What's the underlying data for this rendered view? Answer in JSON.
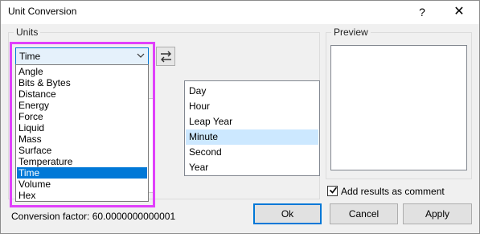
{
  "window": {
    "title": "Unit Conversion",
    "help_glyph": "?",
    "close_glyph": "✕"
  },
  "units_group": {
    "legend": "Units",
    "selected_category": "Time",
    "category_options": [
      "Angle",
      "Bits & Bytes",
      "Distance",
      "Energy",
      "Force",
      "Liquid",
      "Mass",
      "Surface",
      "Temperature",
      "Time",
      "Volume",
      "Hex"
    ],
    "selected_index": 9,
    "swap_icon": "swap-arrows-icon"
  },
  "unit_list": {
    "items": [
      "Day",
      "Hour",
      "Leap Year",
      "Minute",
      "Second",
      "Year"
    ],
    "selected_index": 3
  },
  "preview_group": {
    "legend": "Preview"
  },
  "options": {
    "add_comment_label": "Add results as comment",
    "add_comment_checked": true
  },
  "status": {
    "conversion_factor": "Conversion factor: 60.0000000000001"
  },
  "buttons": {
    "ok": "Ok",
    "cancel": "Cancel",
    "apply": "Apply"
  },
  "colors": {
    "accent": "#0078d7",
    "highlight": "#e040fb",
    "list_selection": "#cce8ff"
  }
}
